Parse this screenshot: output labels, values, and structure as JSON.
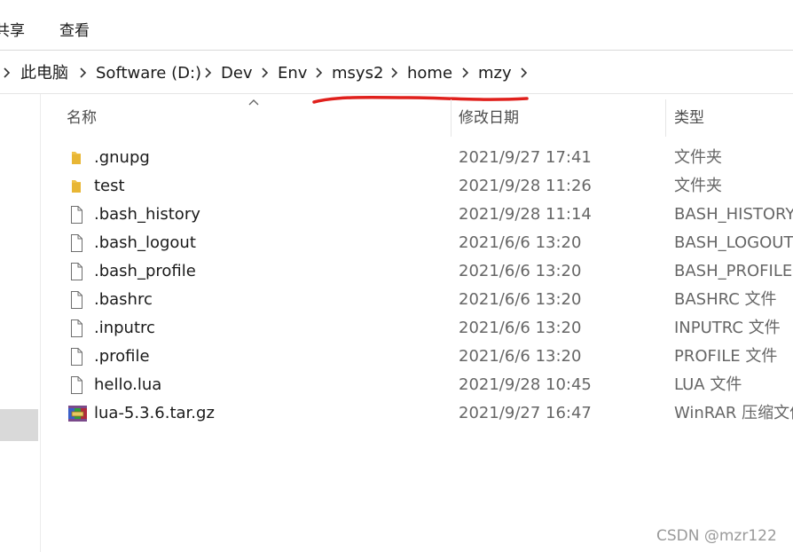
{
  "ribbon": {
    "tabs": [
      "共享",
      "查看"
    ]
  },
  "address_bar": {
    "breadcrumb": [
      "此电脑",
      "Software (D:)",
      "Dev",
      "Env",
      "msys2",
      "home",
      "mzy"
    ]
  },
  "columns": {
    "name": "名称",
    "date_modified": "修改日期",
    "type": "类型"
  },
  "files": [
    {
      "name": ".gnupg",
      "date": "2021/9/27 17:41",
      "type": "文件夹",
      "icon": "folder-icon"
    },
    {
      "name": "test",
      "date": "2021/9/28 11:26",
      "type": "文件夹",
      "icon": "folder-icon"
    },
    {
      "name": ".bash_history",
      "date": "2021/9/28 11:14",
      "type": "BASH_HISTORY",
      "icon": "file-icon"
    },
    {
      "name": ".bash_logout",
      "date": "2021/6/6 13:20",
      "type": "BASH_LOGOUT",
      "icon": "file-icon"
    },
    {
      "name": ".bash_profile",
      "date": "2021/6/6 13:20",
      "type": "BASH_PROFILE 文",
      "icon": "file-icon"
    },
    {
      "name": ".bashrc",
      "date": "2021/6/6 13:20",
      "type": "BASHRC 文件",
      "icon": "file-icon"
    },
    {
      "name": ".inputrc",
      "date": "2021/6/6 13:20",
      "type": "INPUTRC 文件",
      "icon": "file-icon"
    },
    {
      "name": ".profile",
      "date": "2021/6/6 13:20",
      "type": "PROFILE 文件",
      "icon": "file-icon"
    },
    {
      "name": "hello.lua",
      "date": "2021/9/28 10:45",
      "type": "LUA 文件",
      "icon": "file-icon"
    },
    {
      "name": "lua-5.3.6.tar.gz",
      "date": "2021/9/27 16:47",
      "type": "WinRAR 压缩文件",
      "icon": "winrar-archive-icon"
    }
  ],
  "colors": {
    "annotation": "#e0201c",
    "folder": "#f0c24a",
    "nav_selected": "#d9d9d9"
  },
  "watermark": "CSDN @mzr122"
}
